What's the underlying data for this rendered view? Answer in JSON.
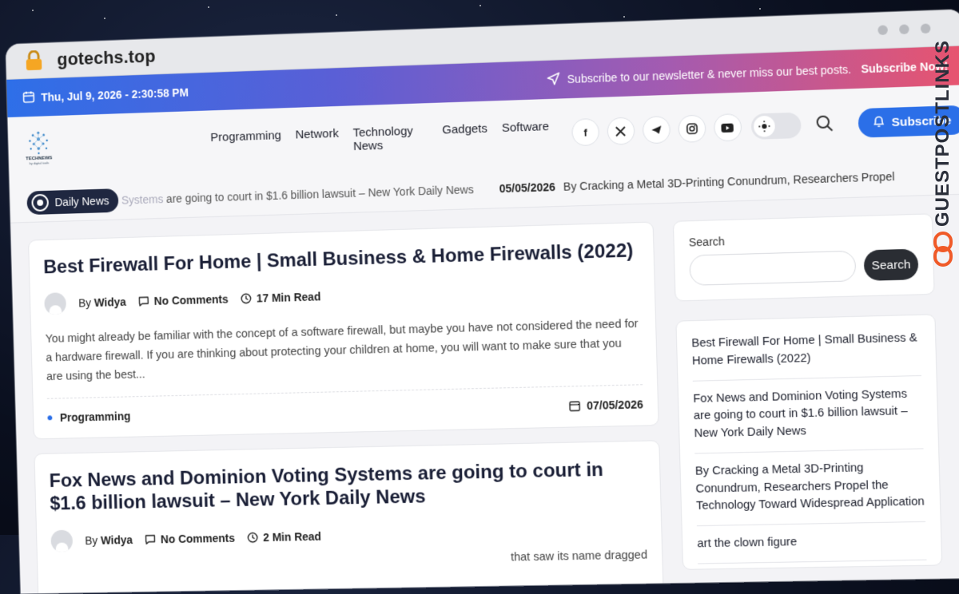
{
  "browser": {
    "url": "gotechs.top"
  },
  "topbar": {
    "datetime": "Thu, Jul 9, 2026 - 2:30:58 PM",
    "newsletter_text": "Subscribe to our newsletter & never miss our best posts.",
    "subscribe_link": "Subscribe Now!"
  },
  "header": {
    "logo_text": "TECHNEWS",
    "logo_sub": "by digital tools",
    "nav": [
      "Programming",
      "Network",
      "Technology News",
      "Gadgets",
      "Software"
    ],
    "socials": [
      "facebook-icon",
      "x-icon",
      "telegram-icon",
      "instagram-icon",
      "youtube-icon"
    ],
    "subscribe_label": "Subscribe"
  },
  "ticker": {
    "badge": "Daily News",
    "item_a_fade": "Systems",
    "item_a": " are going to court in $1.6 billion lawsuit – New York Daily News",
    "item_b_date": "05/05/2026",
    "item_b": "By Cracking a Metal 3D-Printing Conundrum, Researchers Propel"
  },
  "posts": [
    {
      "title": "Best Firewall For Home | Small Business & Home Firewalls (2022)",
      "by": "By",
      "author": "Widya",
      "comments": "No Comments",
      "read": "17 Min Read",
      "excerpt": "You might already be familiar with the concept of a software firewall, but maybe you have not considered the need for a hardware firewall. If you are thinking about protecting your children at home, you will want to make sure that you are using the best...",
      "category": "Programming",
      "date": "07/05/2026"
    },
    {
      "title": "Fox News and Dominion Voting Systems are going to court in $1.6 billion lawsuit – New York Daily News",
      "by": "By",
      "author": "Widya",
      "comments": "No Comments",
      "read": "2 Min Read",
      "excerpt_partial": "that saw its name dragged"
    }
  ],
  "sidebar": {
    "search_label": "Search",
    "search_button": "Search",
    "recent": [
      "Best Firewall For Home | Small Business & Home Firewalls (2022)",
      "Fox News and Dominion Voting Systems are going to court in $1.6 billion lawsuit – New York Daily News",
      "By Cracking a Metal 3D-Printing Conundrum, Researchers Propel the Technology Toward Widespread Application",
      "art the clown figure"
    ]
  },
  "watermark": {
    "text": "GUESTPOSTLINKS"
  },
  "colors": {
    "accent": "#2b6fe8",
    "dark": "#1f2740",
    "gradient_end": "#e8546e"
  }
}
